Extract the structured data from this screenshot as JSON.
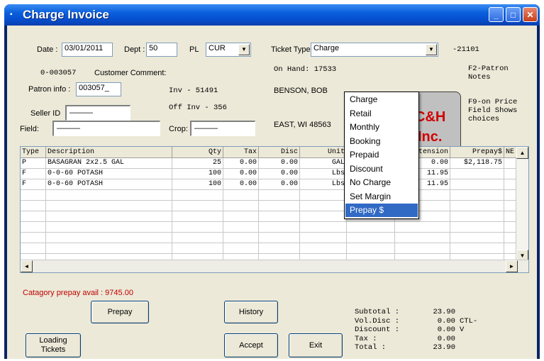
{
  "window": {
    "title": "Charge Invoice",
    "minimize_glyph": "_",
    "maximize_glyph": "□",
    "close_glyph": "✕"
  },
  "header": {
    "date_label": "Date :",
    "date_value": "03/01/2011",
    "dept_label": "Dept :",
    "dept_value": "50",
    "pl_label": "PL",
    "pl_value": "CUR",
    "ticket_type_label": "Ticket Type :",
    "ticket_type_value": "Charge",
    "ticket_number": "-21101",
    "account_code": "0-003057",
    "customer_comment_label": "Customer Comment:",
    "patron_info_label": "Patron info :",
    "patron_info_value": "003057_",
    "inv_label": "Inv - 51491",
    "off_inv_label": "Off Inv - 356",
    "seller_id_label": "Seller ID",
    "seller_id_value": "———",
    "field_label": "Field:",
    "field_value": "———",
    "crop_label": "Crop:",
    "crop_value": "———",
    "on_hand": "On Hand: 17533",
    "customer_name": "BENSON, BOB",
    "customer_address": "EAST, WI 48563",
    "logo_text_1": "C&H",
    "logo_text_2": "Inc.",
    "help_f2": "F2-Patron\nNotes",
    "help_f9": "F9-on Price\nField Shows\nchoices"
  },
  "ticket_type_menu": {
    "options": [
      "Charge",
      "Retail",
      "Monthly",
      "Booking",
      "Prepaid",
      "Discount",
      "No Charge",
      "Set Margin",
      "Prepay $"
    ],
    "selected_index": 8
  },
  "grid": {
    "columns": [
      "Type",
      "Description",
      "Qty",
      "Tax",
      "Disc",
      "Unit",
      "",
      "Extension",
      "Prepay$",
      "NE"
    ],
    "rows": [
      [
        "P",
        "BASAGRAN  2x2.5 GAL",
        "25",
        "0.00",
        "0.00",
        "GAL",
        "",
        "0.00",
        "$2,118.75",
        ""
      ],
      [
        "F",
        "0-0-60 POTASH",
        "100",
        "0.00",
        "0.00",
        "Lbs",
        "",
        "11.95",
        "",
        ""
      ],
      [
        "F",
        "0-0-60 POTASH",
        "100",
        "0.00",
        "0.00",
        "Lbs",
        "",
        "11.95",
        "",
        ""
      ]
    ]
  },
  "footer": {
    "category_prepay": "Catagory prepay avail : 9745.00",
    "prepay_button": "Prepay",
    "history_button": "History",
    "loading_tickets_button": "Loading\nTickets",
    "accept_button": "Accept",
    "exit_button": "Exit",
    "totals": [
      {
        "label": "Subtotal :",
        "value": "23.90",
        "note": ""
      },
      {
        "label": "Vol.Disc :",
        "value": "0.00",
        "note": "CTL-V"
      },
      {
        "label": "Discount :",
        "value": "0.00",
        "note": ""
      },
      {
        "label": "Tax :",
        "value": "0.00",
        "note": ""
      },
      {
        "label": "Total :",
        "value": "23.90",
        "note": ""
      }
    ]
  },
  "colors": {
    "title_bar": "#0a5fdc",
    "menu_highlight": "#316ac5",
    "prepay_text": "#c00000",
    "logo_text": "#d00000"
  }
}
